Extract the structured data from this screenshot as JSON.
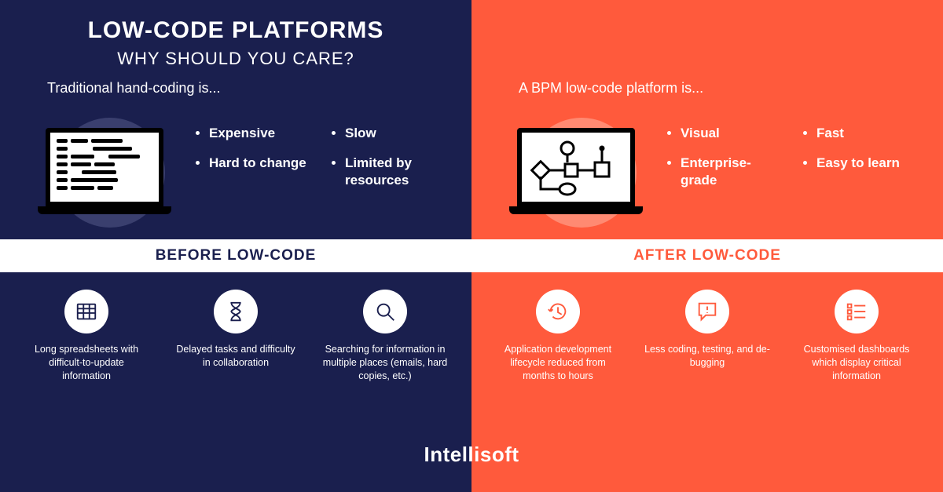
{
  "header": {
    "title": "LOW-CODE PLATFORMS",
    "subtitle": "WHY SHOULD YOU CARE?"
  },
  "left": {
    "intro": "Traditional hand-coding is...",
    "bullets": [
      "Expensive",
      "Slow",
      "Hard to change",
      "Limited by resources"
    ],
    "band": "BEFORE LOW-CODE",
    "items": [
      "Long spreadsheets with difficult-to-update information",
      "Delayed tasks and difficulty in collaboration",
      "Searching for information in multiple places (emails, hard copies, etc.)"
    ]
  },
  "right": {
    "intro": "A BPM low-code platform is...",
    "bullets": [
      "Visual",
      "Fast",
      "Enterprise-grade",
      "Easy to learn"
    ],
    "band": "AFTER LOW-CODE",
    "items": [
      "Application development lifecycle reduced from months to hours",
      "Less coding, testing, and de-bugging",
      "Customised dashboards which display critical information"
    ]
  },
  "brand": "Intellisoft"
}
